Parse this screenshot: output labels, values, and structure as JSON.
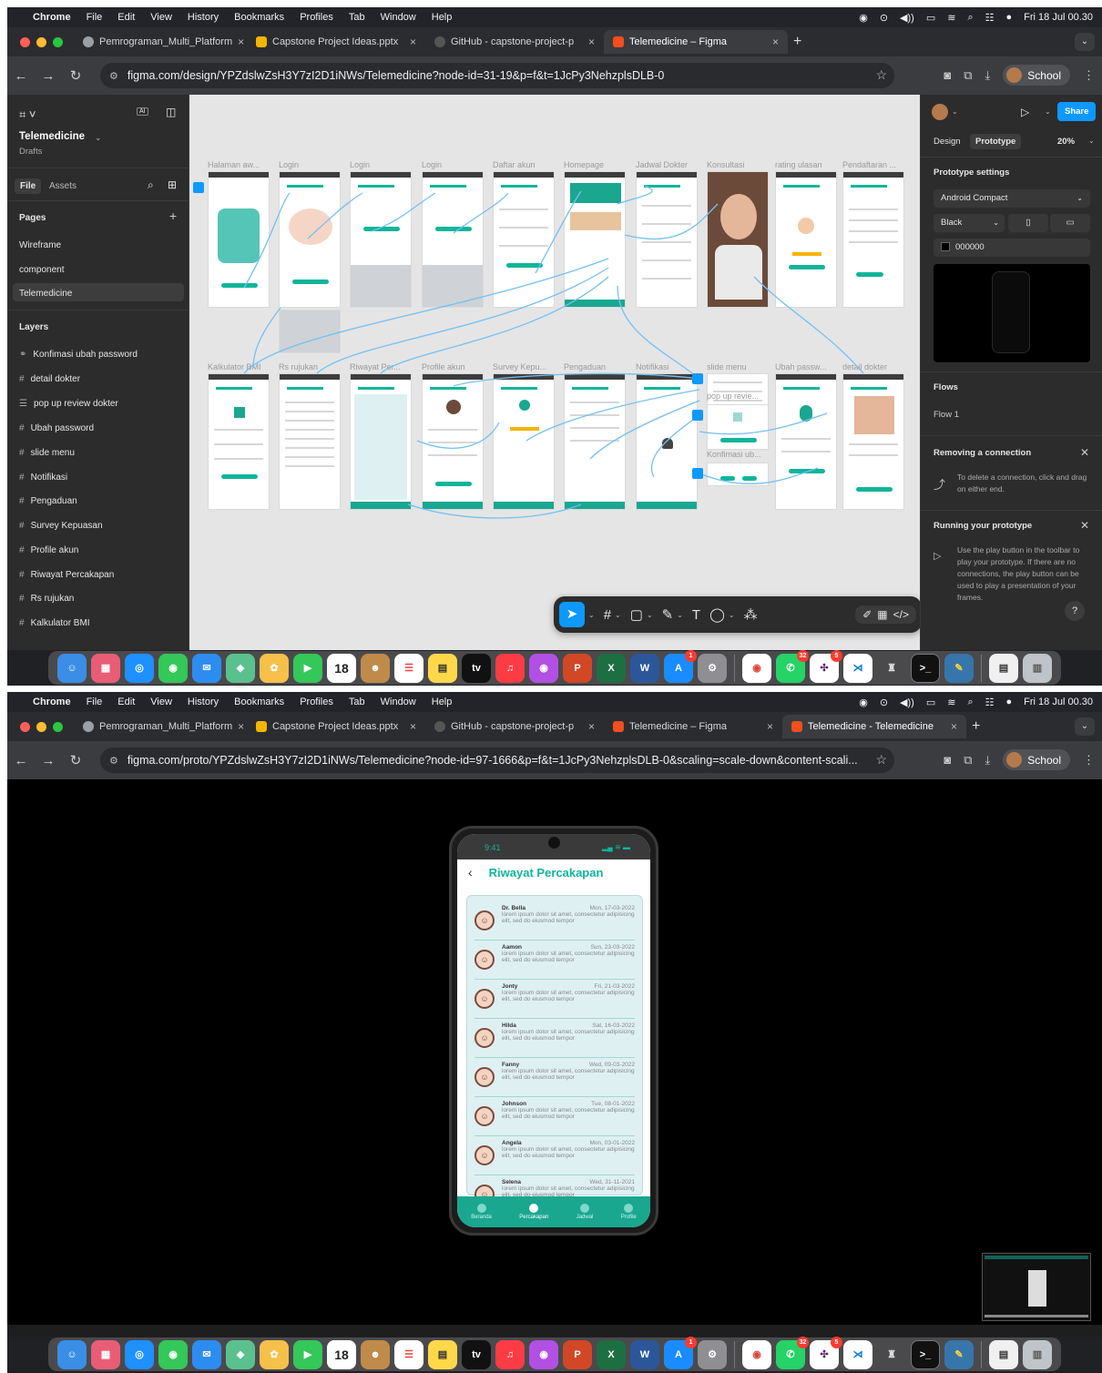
{
  "menubar": {
    "apple": "",
    "items": [
      "Chrome",
      "File",
      "Edit",
      "View",
      "History",
      "Bookmarks",
      "Profiles",
      "Tab",
      "Window",
      "Help"
    ],
    "clock": "Fri 18 Jul 00.30"
  },
  "browser1": {
    "tabs": [
      {
        "label": "Pemrograman_Multi_Platform",
        "icon_color": "#9aa0a6"
      },
      {
        "label": "Capstone Project Ideas.pptx",
        "icon_color": "#f4b400"
      },
      {
        "label": "GitHub - capstone-project-p",
        "icon_color": "#555555"
      },
      {
        "label": "Telemedicine – Figma",
        "icon_color": "#f24e1e"
      }
    ],
    "url": "figma.com/design/YPZdslwZsH3Y7zI2D1iNWs/Telemedicine?node-id=31-19&p=f&t=1JcPy3NehzplsDLB-0",
    "profile_label": "School"
  },
  "browser2": {
    "tabs": [
      {
        "label": "Pemrograman_Multi_Platform",
        "icon_color": "#9aa0a6"
      },
      {
        "label": "Capstone Project Ideas.pptx",
        "icon_color": "#f4b400"
      },
      {
        "label": "GitHub - capstone-project-p",
        "icon_color": "#555555"
      },
      {
        "label": "Telemedicine – Figma",
        "icon_color": "#f24e1e"
      },
      {
        "label": "Telemedicine - Telemedicine",
        "icon_color": "#f24e1e"
      }
    ],
    "url": "figma.com/proto/YPZdslwZsH3Y7zI2D1iNWs/Telemedicine?node-id=97-1666&p=f&t=1JcPy3NehzplsDLB-0&scaling=scale-down&content-scali...",
    "profile_label": "School"
  },
  "figma": {
    "file_name": "Telemedicine",
    "file_location": "Drafts",
    "left_tabs": {
      "file": "File",
      "assets": "Assets"
    },
    "pages_label": "Pages",
    "pages": [
      "Wireframe",
      "component",
      "Telemedicine"
    ],
    "layers_label": "Layers",
    "layers": [
      "Konfimasi ubah password",
      "detail dokter",
      "pop up review dokter",
      "Ubah password",
      "slide menu",
      "Notifikasi",
      "Pengaduan",
      "Survey Kepuasan",
      "Profile akun",
      "Riwayat Percakapan",
      "Rs rujukan",
      "Kalkulator BMI"
    ],
    "frames_row1": [
      "Halaman aw...",
      "Login",
      "Login",
      "Login",
      "Daftar akun",
      "Homepage",
      "Jadwal Dokter",
      "Konsultasi",
      "rating ulasan",
      "Pendaftaran ..."
    ],
    "frames_row2": [
      "Kalkulator BMI",
      "Rs rujukan",
      "Riwayat Per...",
      "Profile akun",
      "Survey Kepu...",
      "Pengaduan",
      "Notifikasi",
      "slide menu",
      "Ubah passw...",
      "detail dokter"
    ],
    "overlay_labels": [
      "pop up revie...",
      "Konfimasi ub..."
    ],
    "right": {
      "tabs": {
        "design": "Design",
        "prototype": "Prototype"
      },
      "zoom": "20%",
      "share": "Share",
      "settings_title": "Prototype settings",
      "device": "Android Compact",
      "model": "Black",
      "bg_color": "000000",
      "flows_title": "Flows",
      "flow": "Flow 1",
      "removing_title": "Removing a connection",
      "removing_help": "To delete a connection, click and drag on either end.",
      "running_title": "Running your prototype",
      "running_help": "Use the play button in the toolbar to play your prototype. If there are no connections, the play button can be used to play a presentation of your frames."
    }
  },
  "proto": {
    "status_time": "9:41",
    "title": "Riwayat Percakapan",
    "chats": [
      {
        "name": "Dr. Bella",
        "date": "Mon, 17-03-2022",
        "text": "lorem ipsum dolor sit amet, consectetur adipisicing elit, sed do eiusmod tempor"
      },
      {
        "name": "Aamon",
        "date": "Sun, 23-03-2022",
        "text": "lorem ipsum dolor sit amet, consectetur adipisicing elit, sed do eiusmod tempor"
      },
      {
        "name": "Jonty",
        "date": "Fri, 21-03-2022",
        "text": "lorem ipsum dolor sit amet, consectetur adipisicing elit, sed do eiusmod tempor"
      },
      {
        "name": "Hilda",
        "date": "Sat, 16-03-2022",
        "text": "lorem ipsum dolor sit amet, consectetur adipisicing elit, sed do eiusmod tempor"
      },
      {
        "name": "Fanny",
        "date": "Wed, 09-03-2022",
        "text": "lorem ipsum dolor sit amet, consectetur adipisicing elit, sed do eiusmod tempor"
      },
      {
        "name": "Johnson",
        "date": "Tue, 08-01-2022",
        "text": "lorem ipsum dolor sit amet, consectetur adipisicing elit, sed do eiusmod tempor"
      },
      {
        "name": "Angela",
        "date": "Mon, 03-01-2022",
        "text": "lorem ipsum dolor sit amet, consectetur adipisicing elit, sed do eiusmod tempor"
      },
      {
        "name": "Selena",
        "date": "Wed, 31-11-2021",
        "text": "lorem ipsum dolor sit amet, consectetur adipisicing elit, sed do eiusmod tempor"
      }
    ],
    "nav": [
      "Beranda",
      "Percakapan",
      "Jadwal",
      "Profile"
    ]
  },
  "dock": {
    "calendar_day": "18",
    "tv_label": "tv",
    "badges": {
      "appstore": "1",
      "whatsapp": "32",
      "slack": "5"
    }
  },
  "colors": {
    "accent": "#0fb59a",
    "figma_blue": "#0d99ff"
  }
}
